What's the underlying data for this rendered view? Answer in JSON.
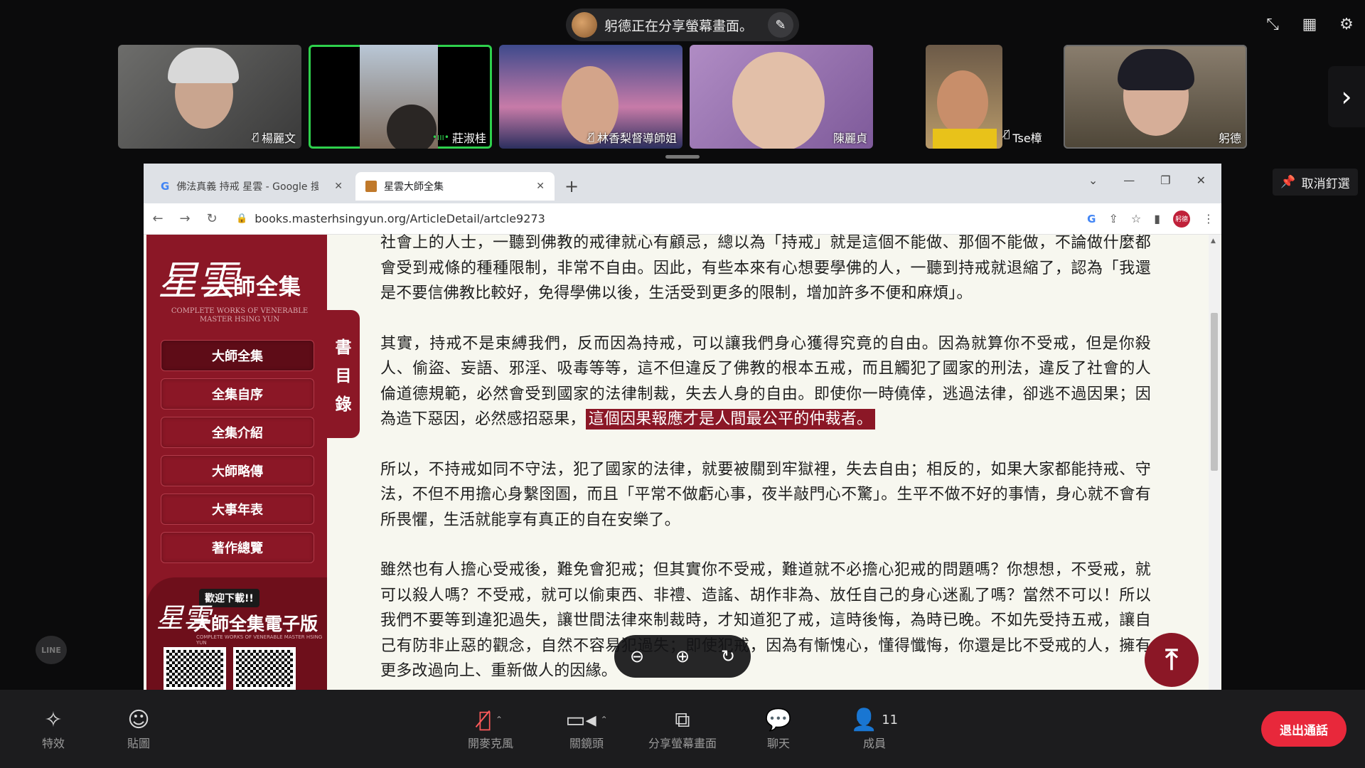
{
  "share_banner": {
    "text": "躬德正在分享螢幕畫面。"
  },
  "participants": [
    {
      "name": "楊麗文",
      "muted": true
    },
    {
      "name": "莊淑桂",
      "muted": false,
      "speaking": true
    },
    {
      "name": "林香梨督導師姐",
      "muted": true
    },
    {
      "name": "陳麗貞",
      "muted": false
    },
    {
      "name": "Tse樟",
      "muted": true
    },
    {
      "name": "躬德",
      "muted": false
    }
  ],
  "unpin_label": "取消釘選",
  "browser": {
    "tabs": [
      {
        "title": "佛法真義 持戒 星雲 - Google 搜尋",
        "active": false
      },
      {
        "title": "星雲大師全集",
        "active": true
      }
    ],
    "url": "books.masterhsingyun.org/ArticleDetail/artcle9273",
    "profile_label": "躬德"
  },
  "site": {
    "logo_script": "星雲",
    "logo_title": "大師全集",
    "logo_sub": "COMPLETE WORKS OF VENERABLE MASTER HSING YUN",
    "menu": [
      "大師全集",
      "全集自序",
      "全集介紹",
      "大師略傳",
      "大事年表",
      "著作總覽"
    ],
    "toc_chars": [
      "書",
      "目",
      "錄"
    ],
    "download_badge": "歡迎下載!!",
    "download_title": "大師全集電子版",
    "download_sub": "COMPLETE WORKS OF VENERABLE MASTER HSING YUN"
  },
  "article": {
    "p1": "社會上的人士，一聽到佛教的戒律就心有顧忌，總以為「持戒」就是這個不能做、那個不能做，不論做什麼都會受到戒條的種種限制，非常不自由。因此，有些本來有心想要學佛的人，一聽到持戒就退縮了，認為「我還是不要信佛教比較好，免得學佛以後，生活受到更多的限制，增加許多不便和麻煩」。",
    "p2_a": "其實，持戒不是束縛我們，反而因為持戒，可以讓我們身心獲得究竟的自由。因為就算你不受戒，但是你殺人、偷盜、妄語、邪淫、吸毒等等，這不但違反了佛教的根本五戒，而且觸犯了國家的刑法，違反了社會的人倫道德規範，必然會受到國家的法律制裁，失去人身的自由。即使你一時僥倖，逃過法律，卻逃不過因果；因為造下惡因，必然感招惡果，",
    "p2_hl": "這個因果報應才是人間最公平的仲裁者。",
    "p3": "所以，不持戒如同不守法，犯了國家的法律，就要被關到牢獄裡，失去自由；相反的，如果大家都能持戒、守法，不但不用擔心身繫囹圄，而且「平常不做虧心事，夜半敲門心不驚」。生平不做不好的事情，身心就不會有所畏懼，生活就能享有真正的自在安樂了。",
    "p4": "雖然也有人擔心受戒後，難免會犯戒；但其實你不受戒，難道就不必擔心犯戒的問題嗎？你想想，不受戒，就可以殺人嗎？不受戒，就可以偷東西、非禮、造謠、胡作非為、放任自己的身心迷亂了嗎？當然不可以！所以我們不要等到違犯過失，讓世間法律來制裁時，才知道犯了戒，這時後悔，為時已晚。不如先受持五戒，讓自己有防非止惡的觀念，自然不容易犯過失；即使犯戒，因為有慚愧心，懂得懺悔，你還是比不受戒的人，擁有更多改過向上、重新做人的因緣。"
  },
  "line_label": "LINE",
  "toolbar": {
    "effects": "特效",
    "stickers": "貼圖",
    "mic": "開麥克風",
    "camera": "關鏡頭",
    "share": "分享螢幕畫面",
    "chat": "聊天",
    "members": "成員",
    "member_count": "11",
    "leave": "退出通話"
  },
  "colors": {
    "accent": "#8b1726",
    "leave": "#e8283b",
    "active_tile": "#2ed04c"
  }
}
